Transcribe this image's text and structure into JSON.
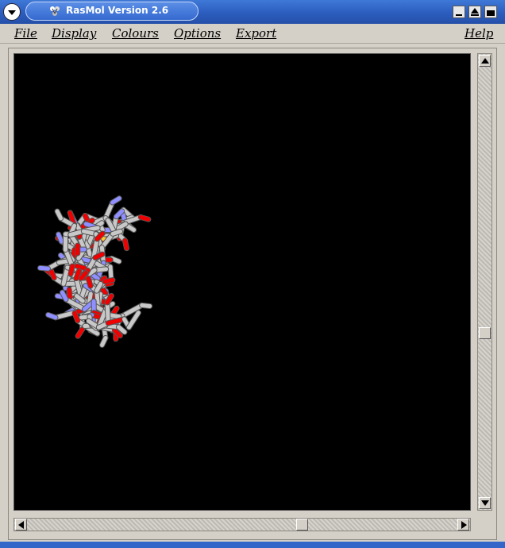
{
  "window": {
    "title": "RasMol Version 2.6"
  },
  "menubar": {
    "items": [
      "File",
      "Display",
      "Colours",
      "Options",
      "Export"
    ],
    "help": "Help"
  },
  "molecule_view": {
    "background": "#000000",
    "colors": {
      "carbon": "#c8c8c8",
      "oxygen": "#f00000",
      "nitrogen": "#8f8fff",
      "sulfur": "#ffc832"
    },
    "render_style": "sticks"
  },
  "scrollbars": {
    "vertical": {
      "thumb_position": 0.62
    },
    "horizontal": {
      "thumb_position": 0.64
    }
  },
  "icons": {
    "window_menu": "window-menu-icon",
    "app": "rasmol-app-icon",
    "minimize": "minimize-icon",
    "maximize": "maximize-icon",
    "close": "close-icon"
  }
}
